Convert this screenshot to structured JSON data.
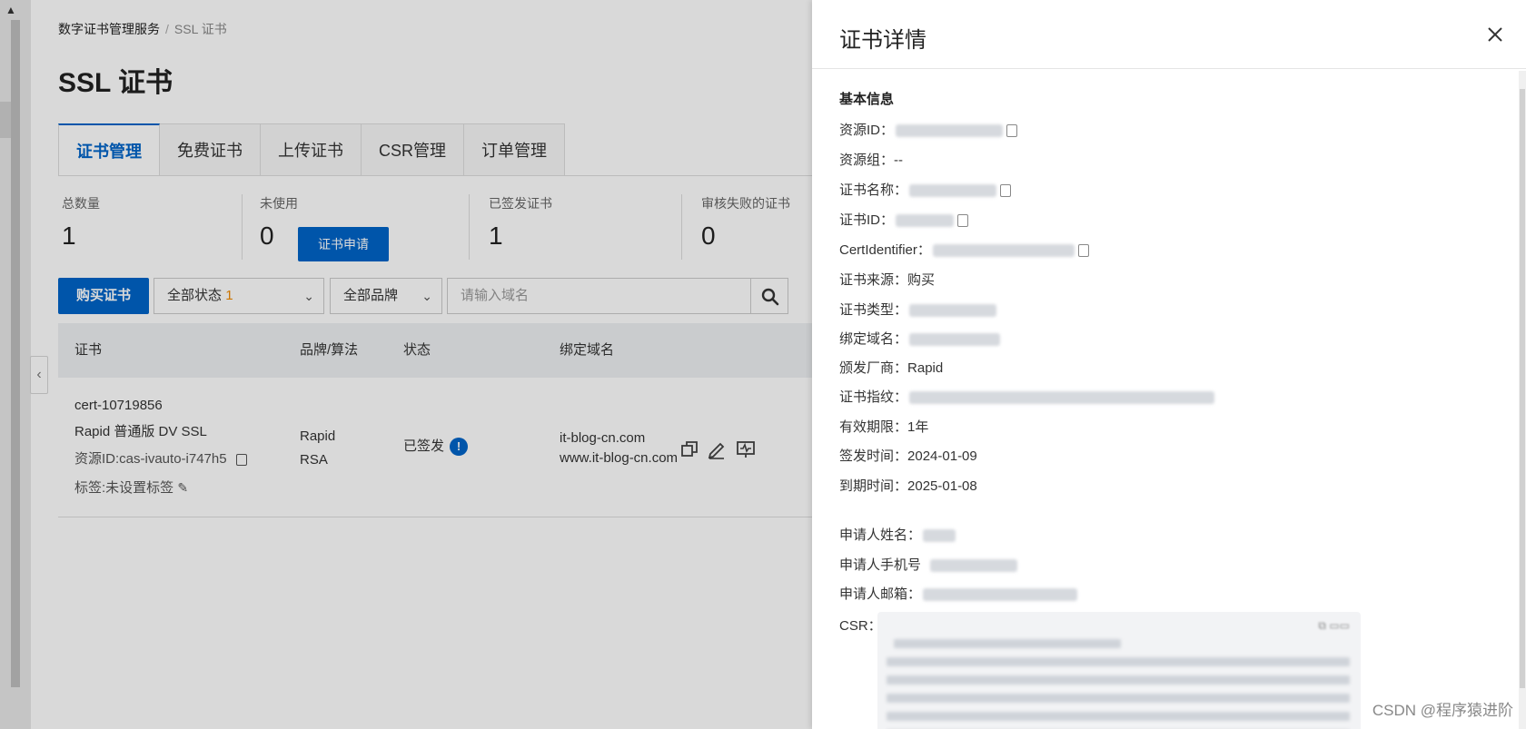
{
  "breadcrumb": {
    "root": "数字证书管理服务",
    "separator": "/",
    "current": "SSL 证书"
  },
  "page_title": "SSL 证书",
  "tabs": [
    {
      "label": "证书管理",
      "active": true
    },
    {
      "label": "免费证书",
      "active": false
    },
    {
      "label": "上传证书",
      "active": false
    },
    {
      "label": "CSR管理",
      "active": false
    },
    {
      "label": "订单管理",
      "active": false
    }
  ],
  "stats": [
    {
      "label": "总数量",
      "value": "1"
    },
    {
      "label": "未使用",
      "value": "0"
    },
    {
      "label": "已签发证书",
      "value": "1"
    },
    {
      "label": "审核失败的证书",
      "value": "0"
    }
  ],
  "apply_button": "证书申请",
  "toolbar": {
    "buy_button": "购买证书",
    "status_filter": "全部状态",
    "status_count": "1",
    "brand_filter": "全部品牌",
    "search_placeholder": "请输入域名"
  },
  "table": {
    "headers": {
      "cert": "证书",
      "brand": "品牌/算法",
      "status": "状态",
      "domain": "绑定域名"
    },
    "row": {
      "name": "cert-10719856",
      "product": "Rapid 普通版 DV SSL",
      "resource_id": "资源ID:cas-ivauto-i747h5",
      "tags": "标签:未设置标签",
      "brand": "Rapid",
      "algorithm": "RSA",
      "status": "已签发",
      "domain1": "it-blog-cn.com",
      "domain2": "www.it-blog-cn.com"
    }
  },
  "drawer": {
    "title": "证书详情",
    "section": "基本信息",
    "fields": {
      "resource_id_label": "资源ID：",
      "resource_group_label": "资源组：",
      "resource_group_value": "--",
      "cert_name_label": "证书名称：",
      "cert_id_label": "证书ID：",
      "cert_identifier_label": "CertIdentifier：",
      "source_label": "证书来源：",
      "source_value": "购买",
      "type_label": "证书类型：",
      "domain_label": "绑定域名：",
      "vendor_label": "颁发厂商：",
      "vendor_value": "Rapid",
      "fingerprint_label": "证书指纹：",
      "validity_label": "有效期限：",
      "validity_value": "1年",
      "issue_label": "签发时间：",
      "issue_value": "2024-01-09",
      "expire_label": "到期时间：",
      "expire_value": "2025-01-08",
      "applicant_name_label": "申请人姓名：",
      "applicant_phone_label": "申请人手机号",
      "applicant_email_label": "申请人邮箱：",
      "csr_label": "CSR："
    }
  },
  "watermark": "CSDN @程序猿进阶",
  "colors": {
    "primary": "#0064c8",
    "accent_count": "#f08a00"
  }
}
